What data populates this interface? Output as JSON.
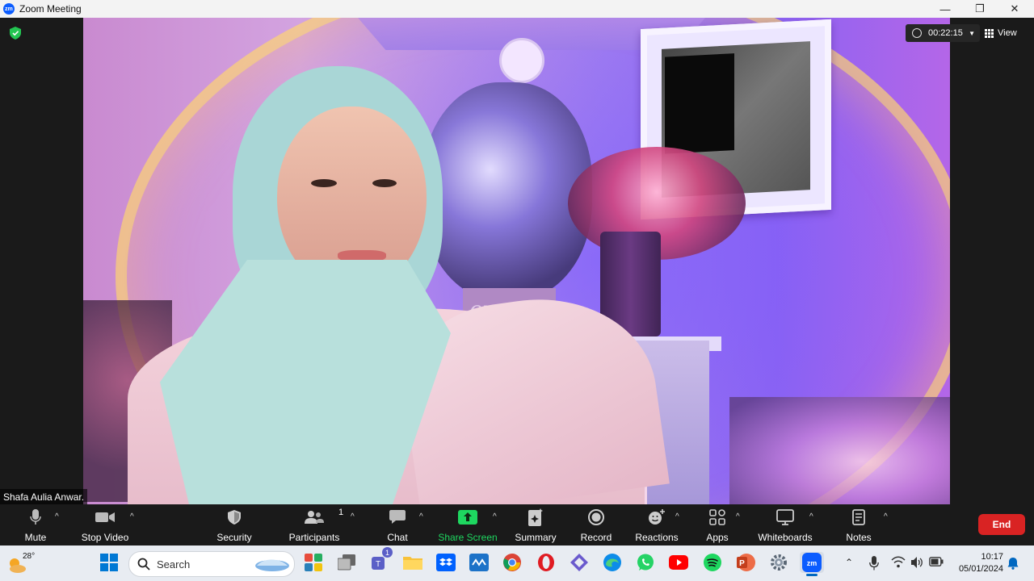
{
  "window": {
    "app_icon_label": "zm",
    "title": "Zoom Meeting",
    "controls": {
      "minimize": "—",
      "restore": "❐",
      "close": "✕"
    }
  },
  "meeting": {
    "timer": "00:22:15",
    "view_label": "View",
    "participant_name": "Shafa Aulia Anwar.",
    "background_sign_text": "ove"
  },
  "toolbar": {
    "mute": "Mute",
    "stop_video": "Stop Video",
    "security": "Security",
    "participants": "Participants",
    "participants_count": "1",
    "chat": "Chat",
    "share_screen": "Share Screen",
    "summary": "Summary",
    "record": "Record",
    "reactions": "Reactions",
    "apps": "Apps",
    "whiteboards": "Whiteboards",
    "notes": "Notes",
    "end": "End"
  },
  "taskbar": {
    "weather_temp": "28°",
    "search_label": "Search",
    "teams_badge": "1",
    "time": "10:17",
    "date": "05/01/2024"
  },
  "colors": {
    "zoom_blue": "#0b5cff",
    "share_green": "#1ed760",
    "end_red": "#d92323"
  }
}
